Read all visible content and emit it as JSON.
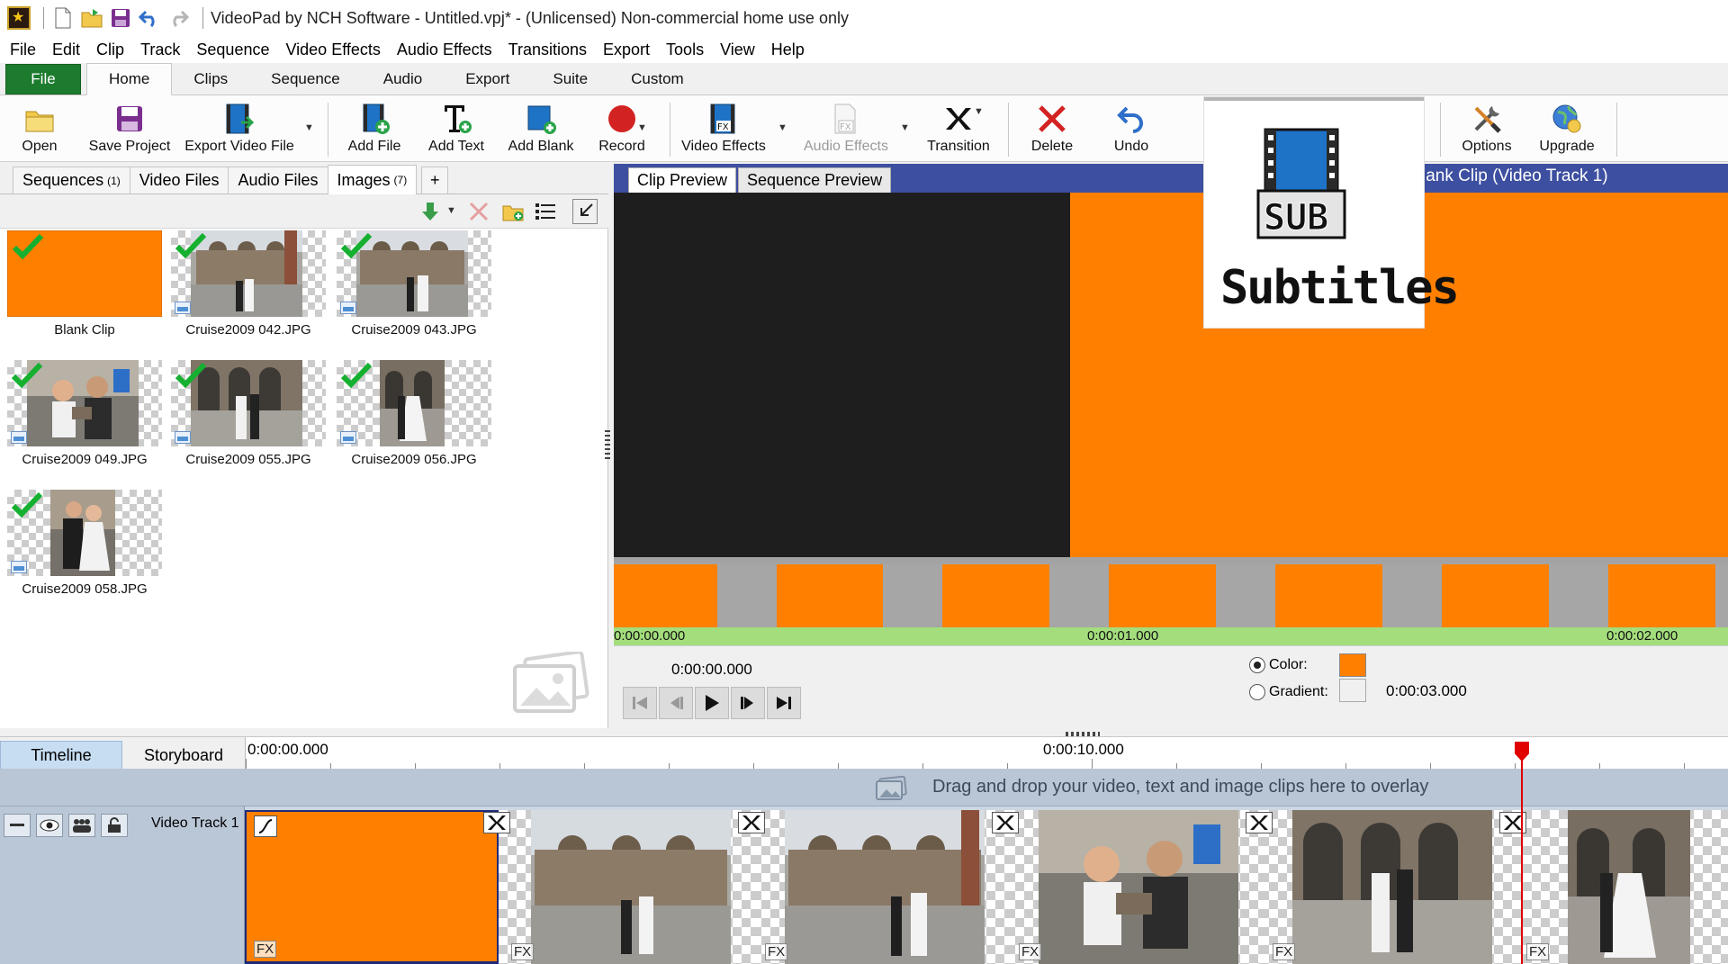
{
  "window": {
    "title": "VideoPad by NCH Software - Untitled.vpj* - (Unlicensed) Non-commercial home use only"
  },
  "menu": [
    "File",
    "Edit",
    "Clip",
    "Track",
    "Sequence",
    "Video Effects",
    "Audio Effects",
    "Transitions",
    "Export",
    "Tools",
    "View",
    "Help"
  ],
  "ribbon_tabs": {
    "file": "File",
    "home": "Home",
    "clips": "Clips",
    "sequence": "Sequence",
    "audio": "Audio",
    "export": "Export",
    "suite": "Suite",
    "custom": "Custom"
  },
  "toolbar": {
    "open": "Open",
    "save_project": "Save Project",
    "export_video_file": "Export Video File",
    "add_file": "Add File",
    "add_text": "Add Text",
    "add_blank": "Add Blank",
    "record": "Record",
    "video_effects": "Video Effects",
    "audio_effects": "Audio Effects",
    "transition": "Transition",
    "delete": "Delete",
    "undo": "Undo",
    "options": "Options",
    "upgrade": "Upgrade"
  },
  "bin": {
    "tabs": {
      "sequences": "Sequences",
      "sequences_count": "(1)",
      "video_files": "Video Files",
      "audio_files": "Audio Files",
      "images": "Images",
      "images_count": "(7)",
      "add": "+"
    },
    "items": [
      {
        "label": "Blank Clip"
      },
      {
        "label": "Cruise2009 042.JPG"
      },
      {
        "label": "Cruise2009 043.JPG"
      },
      {
        "label": "Cruise2009 049.JPG"
      },
      {
        "label": "Cruise2009 055.JPG"
      },
      {
        "label": "Cruise2009 056.JPG"
      },
      {
        "label": "Cruise2009 058.JPG"
      }
    ]
  },
  "preview": {
    "tabs": {
      "clip": "Clip Preview",
      "sequence": "Sequence Preview"
    },
    "title": "lank Clip (Video Track 1)",
    "ruler": [
      "0:00:00.000",
      "0:00:01.000",
      "0:00:02.000"
    ],
    "current_time": "0:00:00.000",
    "color_label": "Color:",
    "gradient_label": "Gradient:",
    "duration": "0:00:03.000",
    "clip_color": "#ff8000"
  },
  "subtitles_overlay": {
    "badge": "SUB",
    "label": "Subtitles"
  },
  "timeline": {
    "tabs": {
      "timeline": "Timeline",
      "storyboard": "Storyboard"
    },
    "ruler": [
      "0:00:00.000",
      "0:00:10.000"
    ],
    "overlay_hint": "Drag and drop your video, text and image clips here to overlay",
    "track_name": "Video Track 1",
    "fx_label": "FX"
  }
}
